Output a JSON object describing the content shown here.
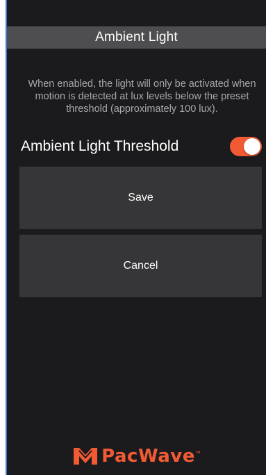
{
  "header": {
    "title": "Ambient Light"
  },
  "description": "When enabled, the light will only be activated when motion is detected at lux levels below the preset threshold (approximately 100 lux).",
  "setting": {
    "label": "Ambient Light Threshold",
    "enabled": true
  },
  "buttons": {
    "save_label": "Save",
    "cancel_label": "Cancel"
  },
  "brand": {
    "name": "PacWave",
    "trademark": "™",
    "logo_icon": "pacwave-logo-icon"
  },
  "colors": {
    "accent": "#f15a33",
    "background": "#1b1b1e",
    "title_bar": "#4e4e50",
    "button": "#363638"
  }
}
